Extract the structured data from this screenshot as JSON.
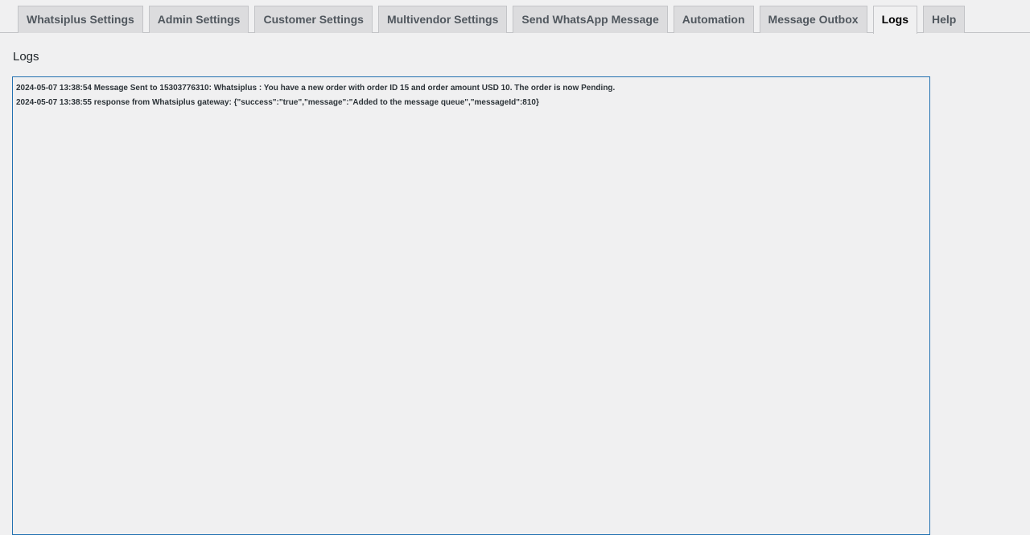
{
  "tabs": [
    {
      "label": "Whatsiplus Settings",
      "active": false
    },
    {
      "label": "Admin Settings",
      "active": false
    },
    {
      "label": "Customer Settings",
      "active": false
    },
    {
      "label": "Multivendor Settings",
      "active": false
    },
    {
      "label": "Send WhatsApp Message",
      "active": false
    },
    {
      "label": "Automation",
      "active": false
    },
    {
      "label": "Message Outbox",
      "active": false
    },
    {
      "label": "Logs",
      "active": true
    },
    {
      "label": "Help",
      "active": false
    }
  ],
  "page": {
    "title": "Logs"
  },
  "logs": [
    "2024-05-07 13:38:54 Message Sent to 15303776310: Whatsiplus : You have a new order with order ID 15 and order amount USD 10. The order is now Pending.",
    "2024-05-07 13:38:55 response from Whatsiplus gateway: {\"success\":\"true\",\"message\":\"Added to the message queue\",\"messageId\":810}"
  ],
  "colors": {
    "background": "#f0f0f1",
    "tab_inactive": "#dcdcde",
    "log_border": "#2271b1"
  }
}
